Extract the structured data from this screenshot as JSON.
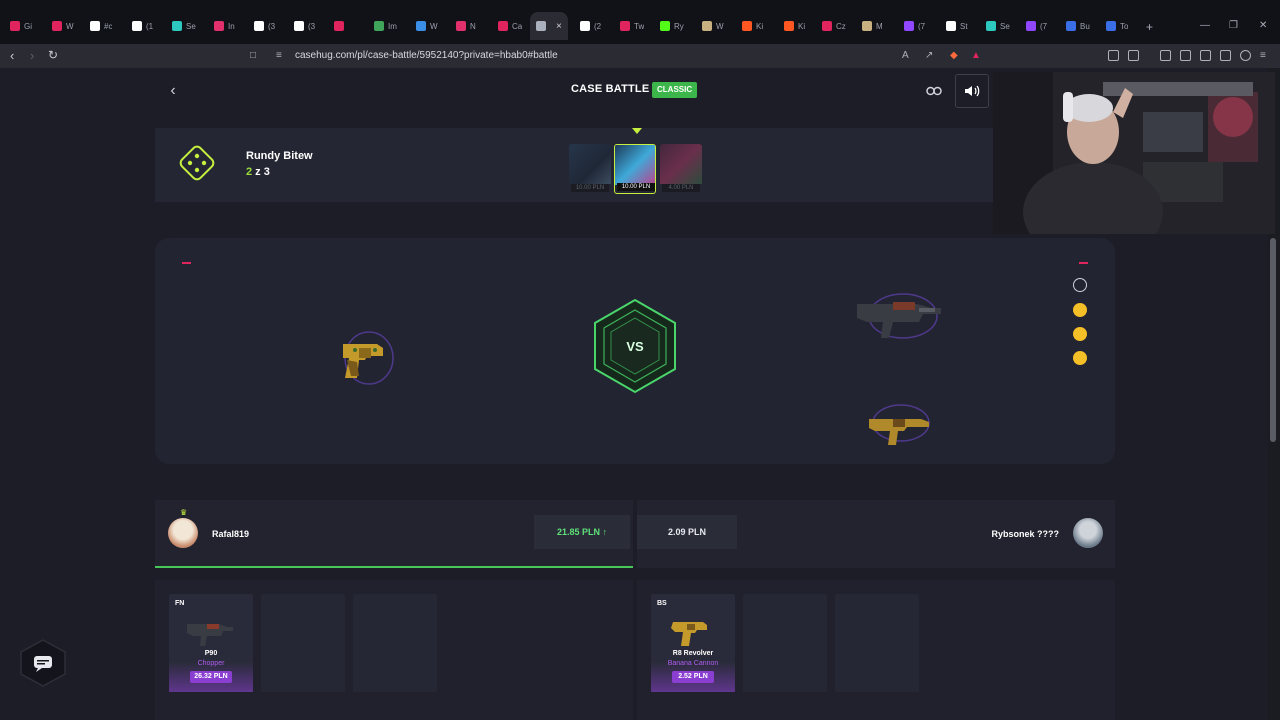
{
  "browser": {
    "tabs": [
      {
        "label": "Gi",
        "color": "#e0245e"
      },
      {
        "label": "W",
        "color": "#e0245e"
      },
      {
        "label": "#c",
        "color": "#ffffff"
      },
      {
        "label": "(1",
        "color": "#ffffff"
      },
      {
        "label": "Se",
        "color": "#2dc8c0"
      },
      {
        "label": "In",
        "color": "#e1306c"
      },
      {
        "label": "(3",
        "color": "#ffffff"
      },
      {
        "label": "(3",
        "color": "#ffffff"
      },
      {
        "label": "",
        "color": "#e0245e"
      },
      {
        "label": "Im",
        "color": "#3ea55a"
      },
      {
        "label": "W",
        "color": "#3a8ee6"
      },
      {
        "label": "N",
        "color": "#e1306c"
      },
      {
        "label": "Ca",
        "color": "#e0245e"
      },
      {
        "label": "",
        "color": "#aab0bc"
      },
      {
        "label": "(2",
        "color": "#ffffff"
      },
      {
        "label": "Tw",
        "color": "#e0245e"
      },
      {
        "label": "Ry",
        "color": "#53fc18"
      },
      {
        "label": "W",
        "color": "#c8b080"
      },
      {
        "label": "Ki",
        "color": "#ff5722"
      },
      {
        "label": "Ki",
        "color": "#ff5722"
      },
      {
        "label": "Cz",
        "color": "#e0245e"
      },
      {
        "label": "M",
        "color": "#c8b080"
      },
      {
        "label": "(7",
        "color": "#9146ff"
      },
      {
        "label": "St",
        "color": "#ffffff"
      },
      {
        "label": "Se",
        "color": "#2dc8c0"
      },
      {
        "label": "(7",
        "color": "#9146ff"
      },
      {
        "label": "Bu",
        "color": "#3a6ee6"
      },
      {
        "label": "To",
        "color": "#3a6ee6"
      }
    ],
    "active_tab_index": 13,
    "url": "casehug.com/pl/case-battle/5952140?private=hbab0#battle"
  },
  "header": {
    "title": "CASE BATTLE",
    "mode_badge": "CLASSIC"
  },
  "rounds": {
    "label": "Rundy Bitew",
    "current": "2",
    "separator": " z ",
    "total": "3",
    "cases": [
      {
        "price": "10.00 PLN",
        "state": "done"
      },
      {
        "price": "10.00 PLN",
        "state": "current"
      },
      {
        "price": "4.00 PLN",
        "state": "upcoming"
      }
    ]
  },
  "arena": {
    "vs_label": "VS",
    "emojis": [
      "smiley-outline-icon",
      "neutral-face-icon",
      "sad-face-icon",
      "surprised-face-icon"
    ]
  },
  "players": [
    {
      "name": "Rafal819",
      "total": "21.85 PLN ↑",
      "winner": true
    },
    {
      "name": "Rybsonek ????",
      "total": "2.09 PLN",
      "winner": false
    }
  ],
  "drops": {
    "left": [
      {
        "condition": "FN",
        "weapon": "P90",
        "skin": "Chopper",
        "price": "26.32 PLN"
      }
    ],
    "right": [
      {
        "condition": "BS",
        "weapon": "R8 Revolver",
        "skin": "Banana Cannon",
        "price": "2.52 PLN"
      }
    ]
  },
  "colors": {
    "accent_green": "#47c75a",
    "badge_green": "#3cb54a",
    "lime": "#c7ef3f",
    "rarity_purple": "#8a3fd1",
    "page_bg": "#1c1d27"
  }
}
